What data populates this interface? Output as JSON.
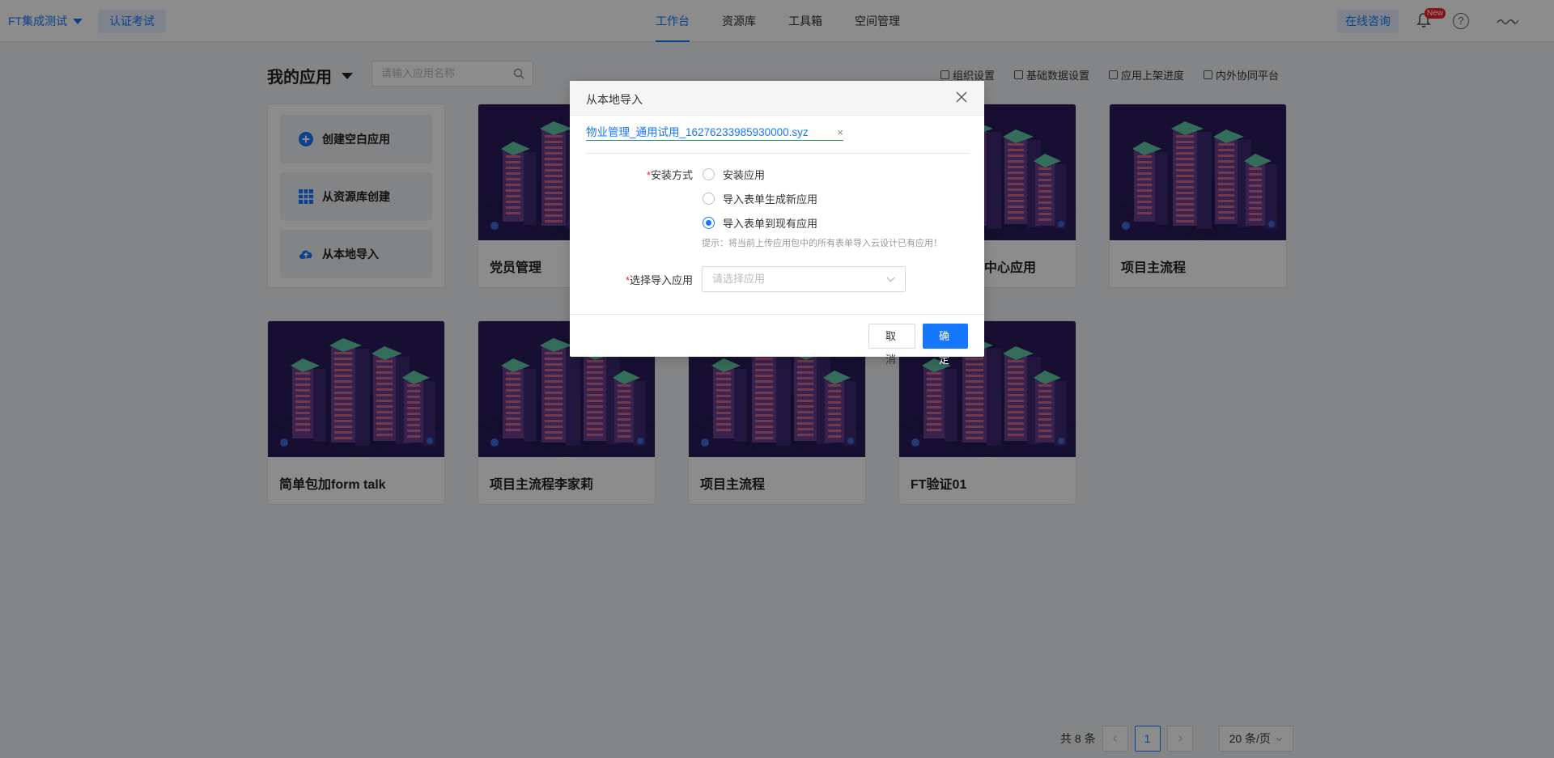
{
  "topbar": {
    "workspace": "FT集成测试",
    "cert_button": "认证考试",
    "nav": [
      "工作台",
      "资源库",
      "工具箱",
      "空间管理"
    ],
    "active_nav": "工作台",
    "consult_button": "在线咨询",
    "new_badge": "New",
    "help_glyph": "?"
  },
  "page": {
    "title": "我的应用",
    "search_placeholder": "请输入应用名称",
    "links": [
      "组织设置",
      "基础数据设置",
      "应用上架进度",
      "内外协同平台"
    ]
  },
  "side_actions": [
    "创建空白应用",
    "从资源库创建",
    "从本地导入"
  ],
  "apps_row1": [
    {
      "name": "党员管理"
    },
    {
      "name": "中心应用"
    },
    {
      "name": "项目主流程"
    }
  ],
  "apps_row2": [
    {
      "name": "简单包加form talk"
    },
    {
      "name": "项目主流程李家莉"
    },
    {
      "name": "项目主流程"
    },
    {
      "name": "FT验证01"
    }
  ],
  "pagination": {
    "total": "共 8 条",
    "current": "1",
    "page_size": "20 条/页"
  },
  "modal": {
    "title": "从本地导入",
    "file_name": "物业管理_通用试用_16276233985930000.syz",
    "install_label": "安装方式",
    "options": [
      "安装应用",
      "导入表单生成新应用",
      "导入表单到现有应用"
    ],
    "selected_option": "导入表单到现有应用",
    "hint": "提示：将当前上传应用包中的所有表单导入云设计已有应用！",
    "select_label": "选择导入应用",
    "select_placeholder": "请选择应用",
    "cancel_button": "取 消",
    "ok_button": "确 定"
  },
  "colors": {
    "primary": "#1677ff",
    "required": "#f5222d",
    "thumb_bg": "#2a1d5c"
  }
}
